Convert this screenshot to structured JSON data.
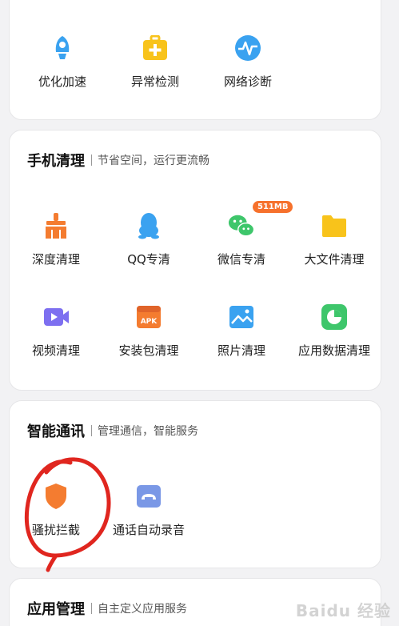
{
  "top_tools": {
    "items": [
      {
        "label": "优化加速",
        "icon": "rocket-icon"
      },
      {
        "label": "异常检测",
        "icon": "medkit-icon"
      },
      {
        "label": "网络诊断",
        "icon": "pulse-icon"
      }
    ]
  },
  "phone_clean": {
    "title": "手机清理",
    "subtitle": "节省空间，运行更流畅",
    "items": [
      {
        "label": "深度清理",
        "icon": "broom-icon"
      },
      {
        "label": "QQ专清",
        "icon": "qq-penguin-icon"
      },
      {
        "label": "微信专清",
        "icon": "wechat-icon",
        "badge": "511MB"
      },
      {
        "label": "大文件清理",
        "icon": "folder-icon"
      },
      {
        "label": "视频清理",
        "icon": "video-icon"
      },
      {
        "label": "安装包清理",
        "icon": "apk-icon",
        "icon_text": "APK"
      },
      {
        "label": "照片清理",
        "icon": "photo-icon"
      },
      {
        "label": "应用数据清理",
        "icon": "pie-chart-icon"
      }
    ]
  },
  "smart_comm": {
    "title": "智能通讯",
    "subtitle": "管理通信，智能服务",
    "items": [
      {
        "label": "骚扰拦截",
        "icon": "shield-icon"
      },
      {
        "label": "通话自动录音",
        "icon": "call-record-icon"
      }
    ]
  },
  "app_manage": {
    "title": "应用管理",
    "subtitle": "自主定义应用服务"
  },
  "watermark": "Baidu 经验",
  "colors": {
    "blue": "#3aa2f0",
    "yellow": "#f8c31b",
    "orange": "#f47c30",
    "green": "#3ec66b",
    "purple": "#7d6ff0",
    "annotation_red": "#e0261f"
  }
}
